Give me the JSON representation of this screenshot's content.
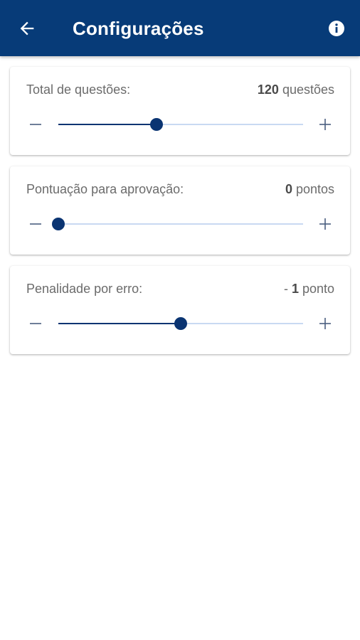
{
  "header": {
    "title": "Configurações",
    "background_color": "#073b78",
    "back_icon": "arrow-left-icon",
    "info_icon": "info-icon"
  },
  "colors": {
    "accent": "#0a3472",
    "track": "#c9d9f2",
    "text": "#6b6b6b"
  },
  "settings": [
    {
      "label": "Total de questões:",
      "value_prefix": "",
      "value_number": "120",
      "value_unit": " questões",
      "slider_fraction": 0.4
    },
    {
      "label": "Pontuação para aprovação:",
      "value_prefix": "",
      "value_number": "0",
      "value_unit": " pontos",
      "slider_fraction": 0.0
    },
    {
      "label": "Penalidade por erro:",
      "value_prefix": "- ",
      "value_number": "1",
      "value_unit": " ponto",
      "slider_fraction": 0.5
    }
  ],
  "controls": {
    "minus_icon": "minus-icon",
    "plus_icon": "plus-icon"
  }
}
